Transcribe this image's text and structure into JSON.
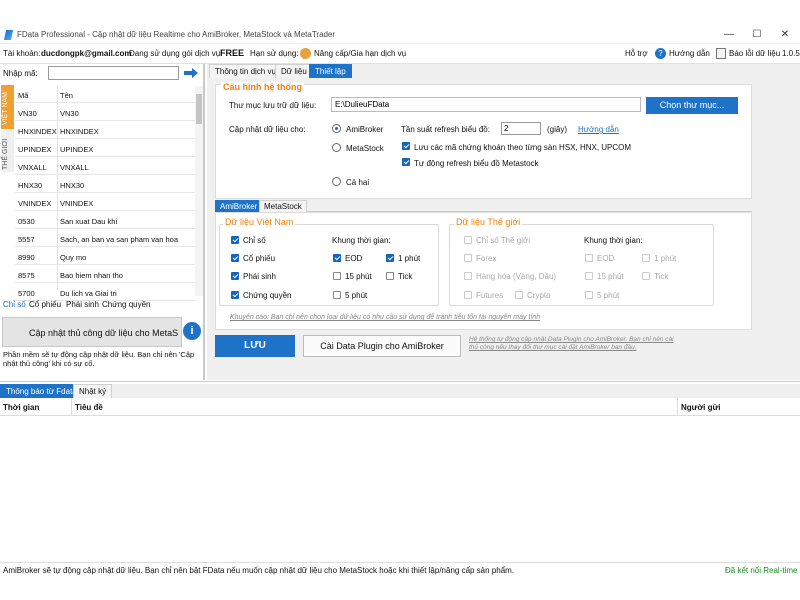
{
  "window": {
    "title": "FData Professional - Cập nhật dữ liệu Realtime cho AmiBroker, MetaStock và MetaTrader",
    "minimize": "—",
    "maximize": "☐",
    "close": "✕"
  },
  "menubar": {
    "account_label": "Tài khoản:",
    "account_value": "ducdongpk@gmail.com",
    "package_label": "Đang sử dụng gói dịch vụ:",
    "package_value": "FREE",
    "expiry_label": "Hạn sử dụng:",
    "upgrade": "Nâng cấp/Gia hạn dịch vụ",
    "support": "Hỗ trợ",
    "guide": "Hướng dẫn",
    "report": "Báo lỗi dữ liệu",
    "version": "1.0.5"
  },
  "left": {
    "input_label": "Nhập mã:",
    "input_value": "",
    "side_tab_vn": "VIỆT NAM",
    "side_tab_world": "THẾ GIỚI",
    "col_code": "Mã",
    "col_name": "Tên",
    "rows": [
      {
        "code": "VN30",
        "name": "VN30"
      },
      {
        "code": "HNXINDEX",
        "name": "HNXINDEX"
      },
      {
        "code": "UPINDEX",
        "name": "UPINDEX"
      },
      {
        "code": "VNXALL",
        "name": "VNXALL"
      },
      {
        "code": "HNX30",
        "name": "HNX30"
      },
      {
        "code": "VNINDEX",
        "name": "VNINDEX"
      },
      {
        "code": "0530",
        "name": "San xuat Dau khi"
      },
      {
        "code": "5557",
        "name": "Sach, an ban va san pham van hoa"
      },
      {
        "code": "8990",
        "name": "Quy mo"
      },
      {
        "code": "8575",
        "name": "Bao hiem nhan tho"
      },
      {
        "code": "5700",
        "name": "Du lich va Giai tri"
      }
    ],
    "bottom_tabs": [
      "Chỉ số",
      "Cổ phiếu",
      "Phái sinh",
      "Chứng quyền"
    ],
    "manual_button": "Cập nhật thủ công dữ liệu cho MetaS",
    "info_text": "Phần mềm sẽ tự động cập nhật dữ liệu. Bạn chỉ nên 'Cập nhật thủ công' khi có sự cố."
  },
  "main": {
    "tabs": [
      "Thông tin dịch vụ",
      "Dữ liệu",
      "Thiết lập"
    ],
    "system_title": "Cấu hình hệ thống",
    "folder_label": "Thư mục lưu trữ dữ liệu:",
    "folder_value": "E:\\DulieuFData",
    "choose_folder": "Chọn thư mục...",
    "update_for_label": "Cập nhật dữ liệu cho:",
    "radio_amibroker": "AmiBroker",
    "radio_metastock": "MetaStock",
    "radio_both": "Cả hai",
    "refresh_label": "Tần suất refresh biểu đồ:",
    "refresh_value": "2",
    "refresh_unit": "(giây)",
    "guide_link": "Hướng dẫn",
    "opt_save_by_exchange": "Lưu các mã chứng khoán theo từng sàn HSX, HNX, UPCOM",
    "opt_auto_refresh": "Tự động refresh biểu đồ Metastock",
    "sub_tabs": [
      "AmiBroker",
      "MetaStock"
    ],
    "vn_title": "Dữ liệu Việt Nam",
    "world_title": "Dữ liệu Thế giới",
    "vn_items": [
      "Chỉ số",
      "Cổ phiếu",
      "Phái sinh",
      "Chứng quyền"
    ],
    "world_items": [
      "Chỉ số Thế giới",
      "Forex",
      "Hàng hóa (Vàng, Dầu)",
      "Futures",
      "Crypto"
    ],
    "timeframe_label": "Khung thời gian:",
    "tf": [
      "EOD",
      "1 phút",
      "15 phút",
      "Tick",
      "5 phút"
    ],
    "recommend": "Khuyến cáo: Bạn chỉ nên chọn loại dữ liệu có nhu cầu sử dụng để tránh tiêu tốn tài nguyên máy tính",
    "save_button": "LƯU",
    "plugin_button": "Cài Data Plugin cho AmiBroker",
    "plugin_note": "Hệ thống tự động cập nhật Data Plugin cho AmiBroker. Bạn chỉ nên cài thủ công nếu thay đổi thư mục cài đặt AmiBroker bạn đầu."
  },
  "bottom": {
    "tabs": [
      "Thông báo từ Fdata",
      "Nhật ký"
    ],
    "col_time": "Thời gian",
    "col_title": "Tiêu đề",
    "col_sender": "Người gửi"
  },
  "status": {
    "text": "AmiBroker sẽ tự động cập nhật dữ liệu. Bạn chỉ nên bật FData nếu muốn cập nhật dữ liệu cho MetaStock hoặc khi thiết lập/nâng cấp sản phẩm.",
    "connection": "Đã kết nối Real-time"
  },
  "colors": {
    "accent": "#1e73c8",
    "orange": "#f08010",
    "green": "#1a8a1a"
  }
}
